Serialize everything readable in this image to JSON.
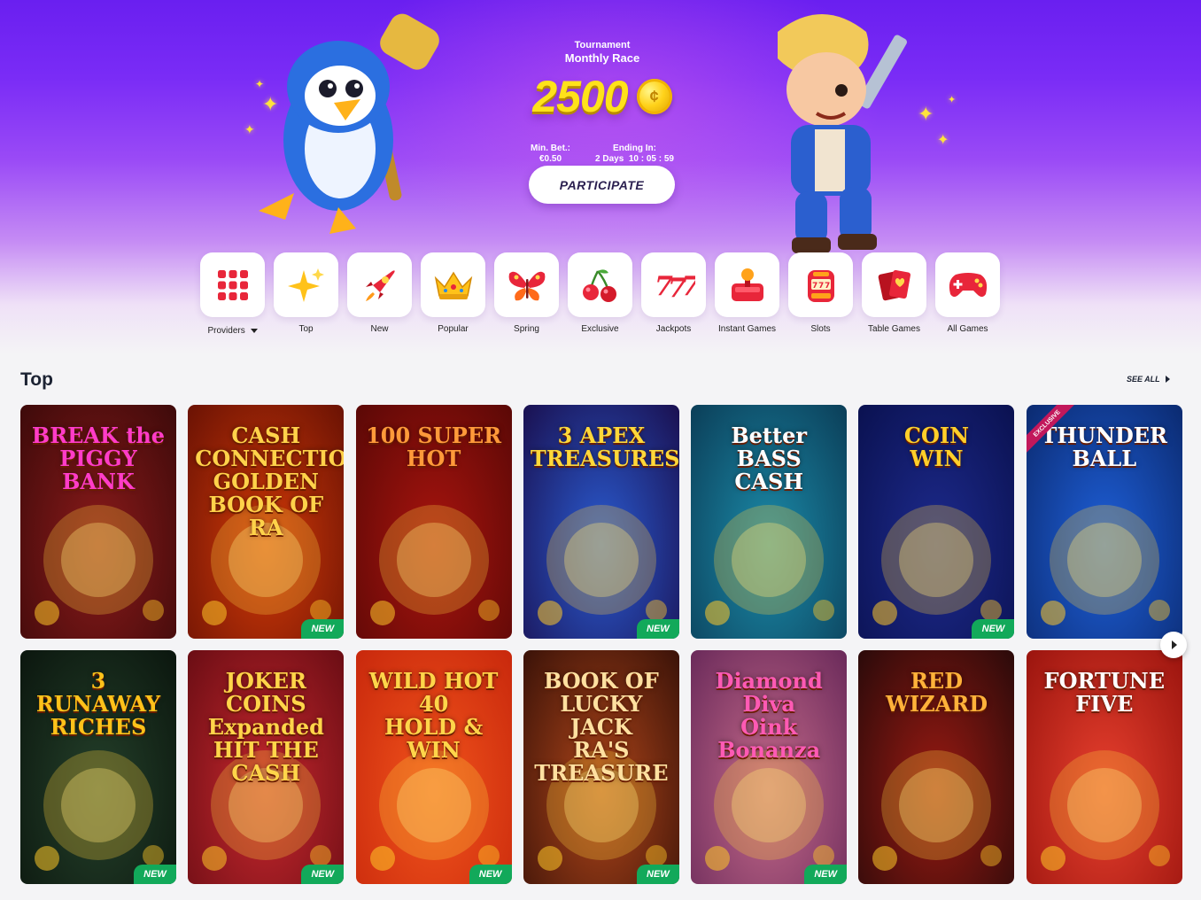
{
  "tournament": {
    "label": "Tournament",
    "name": "Monthly Race",
    "amount": "2500",
    "min_bet_label": "Min. Bet.:",
    "min_bet_value": "€0.50",
    "ending_label": "Ending In:",
    "ending_value": "2 Days  10 : 05 : 59",
    "participate_label": "PARTICIPATE"
  },
  "categories": [
    {
      "label": "Providers",
      "icon": "grid-icon"
    },
    {
      "label": "Top",
      "icon": "sparkle-icon"
    },
    {
      "label": "New",
      "icon": "rocket-icon"
    },
    {
      "label": "Popular",
      "icon": "crown-icon"
    },
    {
      "label": "Spring",
      "icon": "butterfly-icon"
    },
    {
      "label": "Exclusive",
      "icon": "cherries-icon"
    },
    {
      "label": "Jackpots",
      "icon": "777-icon"
    },
    {
      "label": "Instant Games",
      "icon": "joystick-icon"
    },
    {
      "label": "Slots",
      "icon": "slot-machine-icon"
    },
    {
      "label": "Table Games",
      "icon": "cards-icon"
    },
    {
      "label": "All Games",
      "icon": "gamepad-icon"
    }
  ],
  "section": {
    "title": "Top",
    "see_all": "SEE ALL"
  },
  "badge_new": "NEW",
  "badge_exclusive": "EXCLUSIVE",
  "games": [
    {
      "title": "BREAK the\nPIGGY BANK",
      "new": false,
      "bg": "#8a1a1a",
      "bg2": "#3d0a0a",
      "title_color": "#ff3cc8"
    },
    {
      "title": "CASH CONNECTION\nGOLDEN\nBOOK OF RA",
      "new": true,
      "bg": "#d23a08",
      "bg2": "#6a1204",
      "title_color": "#ffd24a"
    },
    {
      "title": "100 SUPER HOT",
      "new": false,
      "bg": "#a8140e",
      "bg2": "#5a0806",
      "title_color": "#ff9a3a"
    },
    {
      "title": "3 APEX\nTREASURES",
      "new": true,
      "bg": "#2a5bd0",
      "bg2": "#1a1050",
      "title_color": "#ffd83a"
    },
    {
      "title": "Better\nBASS\nCASH",
      "new": false,
      "bg": "#1b8aa8",
      "bg2": "#0b3e58",
      "title_color": "#ffffff"
    },
    {
      "title": "COIN\nWIN",
      "new": true,
      "bg": "#1d2a8c",
      "bg2": "#0a1150",
      "title_color": "#ffcf2a"
    },
    {
      "title": "THUNDER\nBALL",
      "new": false,
      "bg": "#1e5fd8",
      "bg2": "#0b2a70",
      "title_color": "#ffffff",
      "exclusive": true
    },
    {
      "title": "3 RUNAWAY\nRICHES",
      "new": true,
      "bg": "#24402a",
      "bg2": "#0b160e",
      "title_color": "#ffc21a"
    },
    {
      "title": "JOKER COINS\nExpanded\nHIT THE CASH",
      "new": true,
      "bg": "#c8282e",
      "bg2": "#6a0d14",
      "title_color": "#ffd54a"
    },
    {
      "title": "WILD HOT 40\nHOLD & WIN",
      "new": true,
      "bg": "#f2541c",
      "bg2": "#c8280c",
      "title_color": "#ffd54a"
    },
    {
      "title": "BOOK OF\nLUCKY JACK\nRA'S TREASURE",
      "new": true,
      "bg": "#b0461a",
      "bg2": "#3a1208",
      "title_color": "#ffe0a0"
    },
    {
      "title": "Diamond Diva\nOink Bonanza",
      "new": true,
      "bg": "#c56a8a",
      "bg2": "#6a2a5a",
      "title_color": "#ff5ab4"
    },
    {
      "title": "RED WIZARD",
      "new": false,
      "bg": "#9a1a12",
      "bg2": "#2a0a0a",
      "title_color": "#ffb23a"
    },
    {
      "title": "FORTUNE\nFIVE",
      "new": false,
      "bg": "#e8402e",
      "bg2": "#9a140e",
      "title_color": "#ffffff"
    }
  ]
}
